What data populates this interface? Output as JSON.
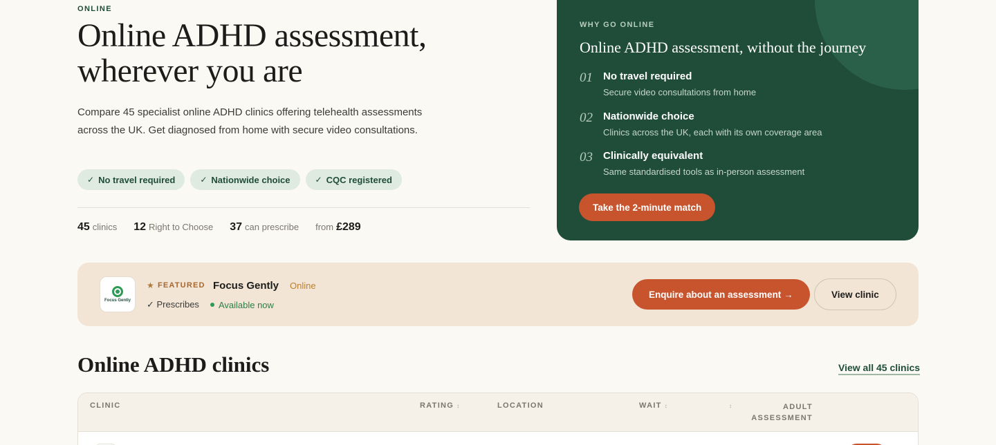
{
  "hero": {
    "eyebrow": "ONLINE",
    "title": "Online ADHD assessment, wherever you are",
    "description": "Compare 45 specialist online ADHD clinics offering telehealth assessments across the UK. Get diagnosed from home with secure video consultations.",
    "pills": [
      "No travel required",
      "Nationwide choice",
      "CQC registered"
    ],
    "stats": [
      {
        "value": "45",
        "label": "clinics"
      },
      {
        "value": "12",
        "label": "Right to Choose"
      },
      {
        "value": "37",
        "label": "can prescribe"
      },
      {
        "prefix": "from",
        "value": "£289"
      }
    ]
  },
  "why": {
    "eyebrow": "WHY GO ONLINE",
    "title": "Online ADHD assessment, without the journey",
    "items": [
      {
        "num": "01",
        "head": "No travel required",
        "sub": "Secure video consultations from home"
      },
      {
        "num": "02",
        "head": "Nationwide choice",
        "sub": "Clinics across the UK, each with its own coverage area"
      },
      {
        "num": "03",
        "head": "Clinically equivalent",
        "sub": "Same standardised tools as in-person assessment"
      }
    ],
    "cta": "Take the 2-minute match"
  },
  "featured": {
    "badge": "FEATURED",
    "logo_text": "Focus Gently",
    "name": "Focus Gently",
    "mode": "Online",
    "prescribes": "Prescribes",
    "available": "Available now",
    "enquire": "Enquire about an assessment →",
    "view": "View clinic"
  },
  "clinics": {
    "title": "Online ADHD clinics",
    "view_all": "View all 45 clinics",
    "columns": {
      "clinic": "CLINIC",
      "rating": "RATING",
      "location": "LOCATION",
      "wait": "WAIT",
      "adult_1": "ADULT",
      "adult_2": "ASSESSMENT"
    }
  },
  "colors": {
    "brand_green": "#1f4d3a",
    "accent_orange": "#c8542e",
    "featured_bg": "#f2e5d6",
    "page_bg": "#fbf9f4"
  }
}
